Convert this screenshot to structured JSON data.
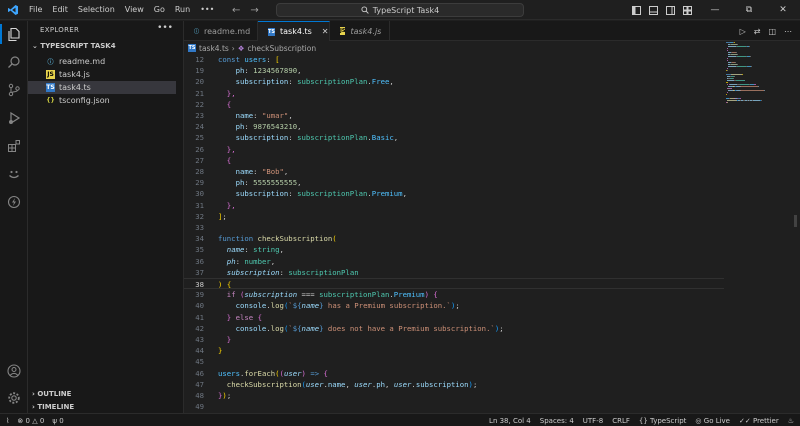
{
  "menu": [
    "File",
    "Edit",
    "Selection",
    "View",
    "Go",
    "Run",
    "•••"
  ],
  "command_center": "TypeScript Task4",
  "explorer": {
    "title": "EXPLORER",
    "more": "•••",
    "folder": "TYPESCRIPT TASK4",
    "files": [
      {
        "name": "readme.md",
        "type": "md",
        "glyph": "ⓘ"
      },
      {
        "name": "task4.js",
        "type": "js",
        "glyph": "JS"
      },
      {
        "name": "task4.ts",
        "type": "ts",
        "glyph": "TS"
      },
      {
        "name": "tsconfig.json",
        "type": "json",
        "glyph": "{}"
      }
    ],
    "outline": "OUTLINE",
    "timeline": "TIMELINE"
  },
  "tabs": [
    {
      "label": "readme.md",
      "glyph": "ⓘ"
    },
    {
      "label": "task4.ts",
      "glyph": "TS",
      "close": "✕"
    },
    {
      "label": "task4.js",
      "glyph": "JS"
    }
  ],
  "breadcrumb": {
    "file": "task4.ts",
    "sep": "›",
    "symbol": "checkSubscription"
  },
  "editor": {
    "current_line": 38,
    "lines": [
      {
        "n": "12",
        "t": [
          [
            "const ",
            "t-kw"
          ],
          [
            "users",
            "t-cst"
          ],
          [
            ": ",
            "t-pun"
          ],
          [
            "[",
            "t-b1"
          ]
        ]
      },
      {
        "n": "19",
        "t": [
          [
            "    ",
            ""
          ],
          [
            "ph",
            "t-prop"
          ],
          [
            ": ",
            "t-pun"
          ],
          [
            "1234567890",
            "t-num"
          ],
          [
            ",",
            "t-pun"
          ]
        ]
      },
      {
        "n": "20",
        "t": [
          [
            "    ",
            ""
          ],
          [
            "subscription",
            "t-prop"
          ],
          [
            ": ",
            "t-pun"
          ],
          [
            "subscriptionPlan",
            "t-type"
          ],
          [
            ".",
            "t-pun"
          ],
          [
            "Free",
            "t-cst"
          ],
          [
            ",",
            "t-pun"
          ]
        ]
      },
      {
        "n": "21",
        "t": [
          [
            "  ",
            ""
          ],
          [
            "},",
            "t-b2"
          ]
        ]
      },
      {
        "n": "22",
        "t": [
          [
            "  ",
            ""
          ],
          [
            "{",
            "t-b2"
          ]
        ]
      },
      {
        "n": "23",
        "t": [
          [
            "    ",
            ""
          ],
          [
            "name",
            "t-prop"
          ],
          [
            ": ",
            "t-pun"
          ],
          [
            "\"umar\"",
            "t-str"
          ],
          [
            ",",
            "t-pun"
          ]
        ]
      },
      {
        "n": "24",
        "t": [
          [
            "    ",
            ""
          ],
          [
            "ph",
            "t-prop"
          ],
          [
            ": ",
            "t-pun"
          ],
          [
            "9876543210",
            "t-num"
          ],
          [
            ",",
            "t-pun"
          ]
        ]
      },
      {
        "n": "25",
        "t": [
          [
            "    ",
            ""
          ],
          [
            "subscription",
            "t-prop"
          ],
          [
            ": ",
            "t-pun"
          ],
          [
            "subscriptionPlan",
            "t-type"
          ],
          [
            ".",
            "t-pun"
          ],
          [
            "Basic",
            "t-cst"
          ],
          [
            ",",
            "t-pun"
          ]
        ]
      },
      {
        "n": "26",
        "t": [
          [
            "  ",
            ""
          ],
          [
            "},",
            "t-b2"
          ]
        ]
      },
      {
        "n": "27",
        "t": [
          [
            "  ",
            ""
          ],
          [
            "{",
            "t-b2"
          ]
        ]
      },
      {
        "n": "28",
        "t": [
          [
            "    ",
            ""
          ],
          [
            "name",
            "t-prop"
          ],
          [
            ": ",
            "t-pun"
          ],
          [
            "\"Bob\"",
            "t-str"
          ],
          [
            ",",
            "t-pun"
          ]
        ]
      },
      {
        "n": "29",
        "t": [
          [
            "    ",
            ""
          ],
          [
            "ph",
            "t-prop"
          ],
          [
            ": ",
            "t-pun"
          ],
          [
            "5555555555",
            "t-num"
          ],
          [
            ",",
            "t-pun"
          ]
        ]
      },
      {
        "n": "30",
        "t": [
          [
            "    ",
            ""
          ],
          [
            "subscription",
            "t-prop"
          ],
          [
            ": ",
            "t-pun"
          ],
          [
            "subscriptionPlan",
            "t-type"
          ],
          [
            ".",
            "t-pun"
          ],
          [
            "Premium",
            "t-cst"
          ],
          [
            ",",
            "t-pun"
          ]
        ]
      },
      {
        "n": "31",
        "t": [
          [
            "  ",
            ""
          ],
          [
            "},",
            "t-b2"
          ]
        ]
      },
      {
        "n": "32",
        "t": [
          [
            "]",
            "t-b1"
          ],
          [
            ";",
            "t-pun"
          ]
        ]
      },
      {
        "n": "33",
        "t": []
      },
      {
        "n": "34",
        "t": [
          [
            "function ",
            "t-kw"
          ],
          [
            "checkSubscription",
            "t-fn"
          ],
          [
            "(",
            "t-b1"
          ]
        ]
      },
      {
        "n": "35",
        "t": [
          [
            "  ",
            ""
          ],
          [
            "name",
            "t-par"
          ],
          [
            ": ",
            "t-pun"
          ],
          [
            "string",
            "t-type"
          ],
          [
            ",",
            "t-pun"
          ]
        ]
      },
      {
        "n": "36",
        "t": [
          [
            "  ",
            ""
          ],
          [
            "ph",
            "t-par"
          ],
          [
            ": ",
            "t-pun"
          ],
          [
            "number",
            "t-type"
          ],
          [
            ",",
            "t-pun"
          ]
        ]
      },
      {
        "n": "37",
        "t": [
          [
            "  ",
            ""
          ],
          [
            "subscription",
            "t-par"
          ],
          [
            ": ",
            "t-pun"
          ],
          [
            "subscriptionPlan",
            "t-type"
          ]
        ]
      },
      {
        "n": "38",
        "t": [
          [
            ")",
            "t-b1"
          ],
          [
            " ",
            "t-pun"
          ],
          [
            "{",
            "t-b1"
          ]
        ]
      },
      {
        "n": "39",
        "t": [
          [
            "  ",
            ""
          ],
          [
            "if",
            "t-ctl"
          ],
          [
            " ",
            "t-pun"
          ],
          [
            "(",
            "t-b2"
          ],
          [
            "subscription",
            "t-par"
          ],
          [
            " === ",
            "t-pun"
          ],
          [
            "subscriptionPlan",
            "t-type"
          ],
          [
            ".",
            "t-pun"
          ],
          [
            "Premium",
            "t-cst"
          ],
          [
            ")",
            "t-b2"
          ],
          [
            " ",
            "t-pun"
          ],
          [
            "{",
            "t-b2"
          ]
        ]
      },
      {
        "n": "40",
        "t": [
          [
            "    ",
            ""
          ],
          [
            "console",
            "t-var"
          ],
          [
            ".",
            "t-pun"
          ],
          [
            "log",
            "t-fn"
          ],
          [
            "(",
            "t-b3"
          ],
          [
            "`",
            "t-str"
          ],
          [
            "${",
            "t-tpl"
          ],
          [
            "name",
            "t-par"
          ],
          [
            "}",
            "t-tpl"
          ],
          [
            " has a Premium subscription.`",
            "t-str"
          ],
          [
            ")",
            "t-b3"
          ],
          [
            ";",
            "t-pun"
          ]
        ]
      },
      {
        "n": "41",
        "t": [
          [
            "  ",
            ""
          ],
          [
            "}",
            "t-b2"
          ],
          [
            " ",
            "t-pun"
          ],
          [
            "else",
            "t-ctl"
          ],
          [
            " ",
            "t-pun"
          ],
          [
            "{",
            "t-b2"
          ]
        ]
      },
      {
        "n": "42",
        "t": [
          [
            "    ",
            ""
          ],
          [
            "console",
            "t-var"
          ],
          [
            ".",
            "t-pun"
          ],
          [
            "log",
            "t-fn"
          ],
          [
            "(",
            "t-b3"
          ],
          [
            "`",
            "t-str"
          ],
          [
            "${",
            "t-tpl"
          ],
          [
            "name",
            "t-par"
          ],
          [
            "}",
            "t-tpl"
          ],
          [
            " does not have a Premium subscription.`",
            "t-str"
          ],
          [
            ")",
            "t-b3"
          ],
          [
            ";",
            "t-pun"
          ]
        ]
      },
      {
        "n": "43",
        "t": [
          [
            "  ",
            ""
          ],
          [
            "}",
            "t-b2"
          ]
        ]
      },
      {
        "n": "44",
        "t": [
          [
            "}",
            "t-b1"
          ]
        ]
      },
      {
        "n": "45",
        "t": []
      },
      {
        "n": "46",
        "t": [
          [
            "users",
            "t-cst"
          ],
          [
            ".",
            "t-pun"
          ],
          [
            "forEach",
            "t-fn"
          ],
          [
            "(",
            "t-b1"
          ],
          [
            "(",
            "t-b2"
          ],
          [
            "user",
            "t-par"
          ],
          [
            ")",
            "t-b2"
          ],
          [
            " => ",
            "t-kw"
          ],
          [
            "{",
            "t-b2"
          ]
        ]
      },
      {
        "n": "47",
        "t": [
          [
            "  ",
            ""
          ],
          [
            "checkSubscription",
            "t-fn"
          ],
          [
            "(",
            "t-b3"
          ],
          [
            "user",
            "t-par"
          ],
          [
            ".",
            "t-pun"
          ],
          [
            "name",
            "t-prop"
          ],
          [
            ", ",
            "t-pun"
          ],
          [
            "user",
            "t-par"
          ],
          [
            ".",
            "t-pun"
          ],
          [
            "ph",
            "t-prop"
          ],
          [
            ", ",
            "t-pun"
          ],
          [
            "user",
            "t-par"
          ],
          [
            ".",
            "t-pun"
          ],
          [
            "subscription",
            "t-prop"
          ],
          [
            ")",
            "t-b3"
          ],
          [
            ";",
            "t-pun"
          ]
        ]
      },
      {
        "n": "48",
        "t": [
          [
            "}",
            "t-b2"
          ],
          [
            ")",
            "t-b1"
          ],
          [
            ";",
            "t-pun"
          ]
        ]
      },
      {
        "n": "49",
        "t": []
      }
    ]
  },
  "status": {
    "errors": "0",
    "warnings": "0",
    "ports": "0",
    "position": "Ln 38, Col 4",
    "spaces": "Spaces: 4",
    "encoding": "UTF-8",
    "eol": "CRLF",
    "language": "TypeScript",
    "golive": "Go Live",
    "prettier": "Prettier"
  },
  "colors": {
    "accent": "#0078d4",
    "bg": "#1f1f1f",
    "sidebar": "#181818"
  }
}
